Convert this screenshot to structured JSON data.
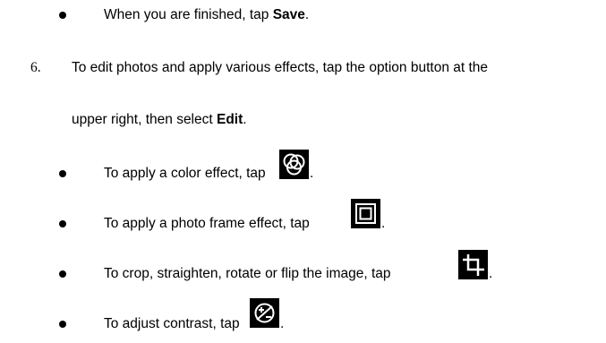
{
  "items": {
    "save": {
      "prefix": "When you are finished, tap ",
      "bold": "Save",
      "suffix": "."
    },
    "step6": {
      "number": "6.",
      "line1": "To edit photos and apply various effects, tap the option button at the",
      "line2_prefix": "upper right, then select ",
      "line2_bold": "Edit",
      "line2_suffix": "."
    },
    "color_effect": {
      "text": "To apply a color effect, tap",
      "suffix": ".",
      "icon": "color-effect-icon"
    },
    "frame_effect": {
      "text": "To apply a photo frame effect, tap",
      "suffix": ".",
      "icon": "frame-icon"
    },
    "crop": {
      "text": "To crop, straighten, rotate or flip the image, tap",
      "suffix": ".",
      "icon": "crop-icon"
    },
    "contrast": {
      "text": "To adjust contrast, tap",
      "suffix": ".",
      "icon": "contrast-icon"
    }
  }
}
